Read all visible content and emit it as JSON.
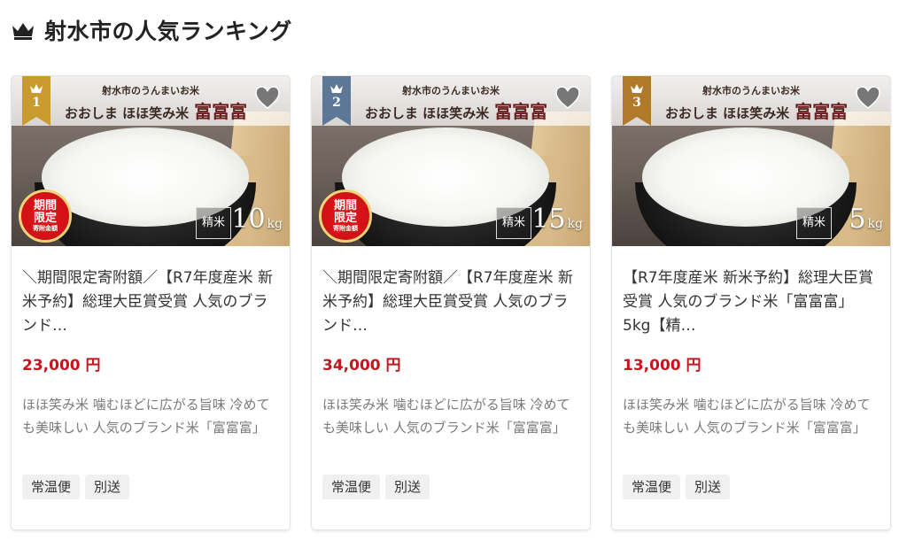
{
  "header": {
    "icon": "crown-icon",
    "title": "射水市の人気ランキング"
  },
  "colors": {
    "rank1": "#c99a2e",
    "rank2": "#5d7896",
    "rank3": "#b07a2a",
    "price": "#c4161c",
    "limited_badge": "#d91319"
  },
  "products": [
    {
      "rank": "1",
      "image": {
        "sub_tag": "射水市のうんまいお米",
        "brand_left": "おおしま ほほ笑み米",
        "brand_big": "富富富",
        "limited": [
          "期間",
          "限定",
          "寄附金額"
        ],
        "kind": "精米",
        "weight": "10",
        "unit": "kg"
      },
      "name": "＼期間限定寄附額／【R7年度産米 新米予約】総理大臣賞受賞 人気のブランド…",
      "price": "23,000 円",
      "description": "ほほ笑み米 噛むほどに広がる旨味 冷めても美味しい 人気のブランド米「富富富」",
      "tags": [
        "常温便",
        "別送"
      ]
    },
    {
      "rank": "2",
      "image": {
        "sub_tag": "射水市のうんまいお米",
        "brand_left": "おおしま ほほ笑み米",
        "brand_big": "富富富",
        "limited": [
          "期間",
          "限定",
          "寄附金額"
        ],
        "kind": "精米",
        "weight": "15",
        "unit": "kg"
      },
      "name": "＼期間限定寄附額／【R7年度産米 新米予約】総理大臣賞受賞 人気のブランド…",
      "price": "34,000 円",
      "description": "ほほ笑み米 噛むほどに広がる旨味 冷めても美味しい 人気のブランド米「富富富」",
      "tags": [
        "常温便",
        "別送"
      ]
    },
    {
      "rank": "3",
      "image": {
        "sub_tag": "射水市のうんまいお米",
        "brand_left": "おおしま ほほ笑み米",
        "brand_big": "富富富",
        "kind": "精米",
        "weight": "5",
        "unit": "kg"
      },
      "name": "【R7年度産米 新米予約】総理大臣賞受賞 人気のブランド米「富富富」5kg【精…",
      "price": "13,000 円",
      "description": "ほほ笑み米 噛むほどに広がる旨味 冷めても美味しい 人気のブランド米「富富富」",
      "tags": [
        "常温便",
        "別送"
      ]
    }
  ]
}
